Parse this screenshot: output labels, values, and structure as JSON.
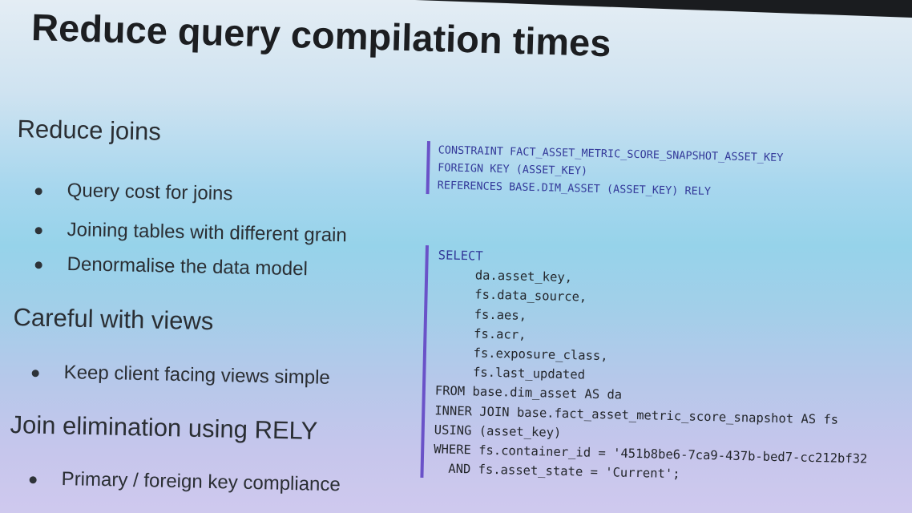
{
  "title": "Reduce query compilation times",
  "sections": [
    {
      "heading": "Reduce joins",
      "bullets": [
        "Query cost for joins",
        "Joining tables with different grain",
        "Denormalise the data model"
      ]
    },
    {
      "heading": "Careful with views",
      "bullets": [
        "Keep client facing views simple"
      ]
    },
    {
      "heading": "Join elimination using RELY",
      "bullets": [
        "Primary / foreign key compliance"
      ]
    }
  ],
  "code_constraint": [
    "CONSTRAINT FACT_ASSET_METRIC_SCORE_SNAPSHOT_ASSET_KEY",
    "FOREIGN KEY (ASSET_KEY)",
    "REFERENCES BASE.DIM_ASSET (ASSET_KEY) RELY"
  ],
  "code_select": [
    "SELECT",
    "     da.asset_key,",
    "     fs.data_source,",
    "     fs.aes,",
    "     fs.acr,",
    "     fs.exposure_class,",
    "     fs.last_updated",
    "FROM base.dim_asset AS da",
    "INNER JOIN base.fact_asset_metric_score_snapshot AS fs",
    "USING (asset_key)",
    "WHERE fs.container_id = '451b8be6-7ca9-437b-bed7-cc212bf32",
    "  AND fs.asset_state = 'Current';"
  ]
}
